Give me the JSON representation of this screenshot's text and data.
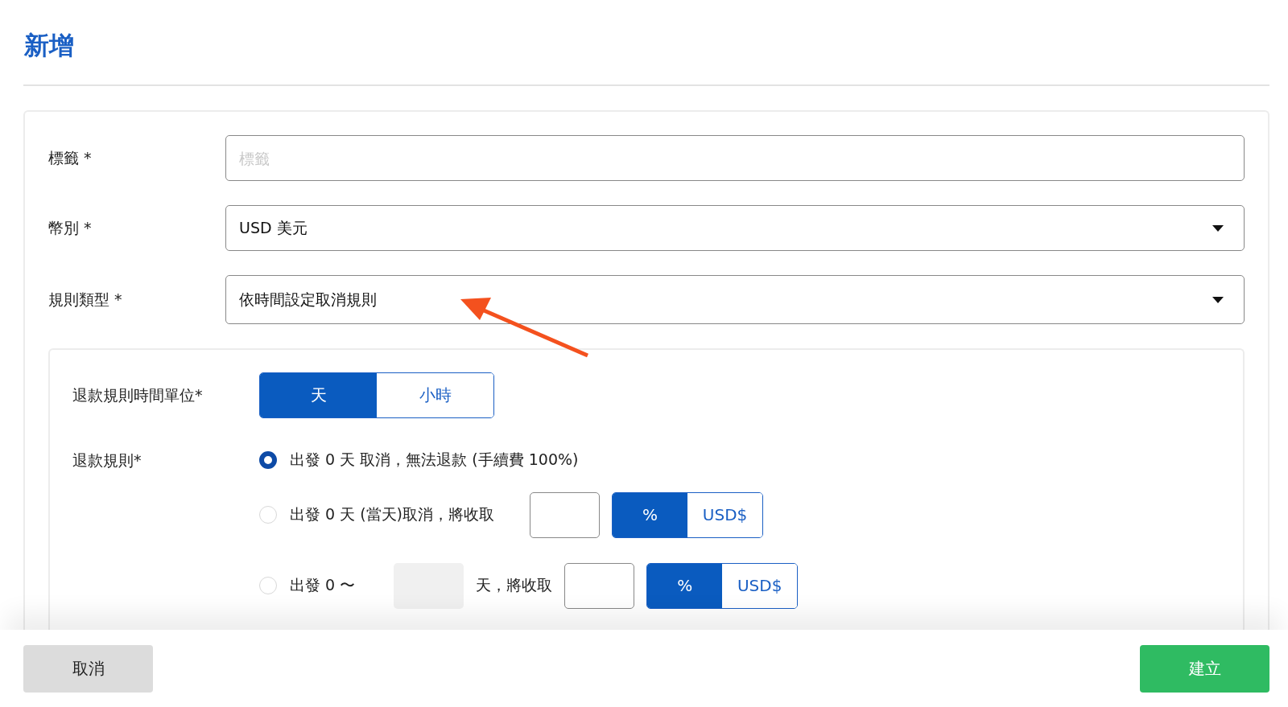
{
  "title": "新增",
  "fields": [
    {
      "kind": "text",
      "label": "標籤 *",
      "placeholder": "標籤"
    },
    {
      "kind": "select",
      "label": "幣別 *",
      "value": "USD 美元"
    },
    {
      "kind": "select",
      "label": "規則類型 *",
      "value": "依時間設定取消規則"
    }
  ],
  "time_unit": {
    "label": "退款規則時間單位*",
    "options": [
      {
        "label": "天",
        "selected": true
      },
      {
        "label": "小時",
        "selected": false
      }
    ]
  },
  "refund_rules": {
    "label": "退款規則*",
    "options": [
      {
        "kind": "fixed",
        "text": "出發 0 天 取消，無法退款 (手續費 100%)",
        "selected": true
      },
      {
        "kind": "same_day",
        "text": "出發 0 天 (當天)取消，將收取",
        "selected": false,
        "units": [
          {
            "label": "%",
            "selected": true
          },
          {
            "label": "USD$",
            "selected": false
          }
        ]
      },
      {
        "kind": "range",
        "text": "出發 0 〜",
        "days_disabled": true,
        "suffix": "天，將收取",
        "selected": false,
        "units": [
          {
            "label": "%",
            "selected": true
          },
          {
            "label": "USD$",
            "selected": false
          }
        ]
      }
    ]
  },
  "annotation": {
    "kind": "arrow"
  },
  "footer": {
    "cancel": "取消",
    "create": "建立"
  }
}
